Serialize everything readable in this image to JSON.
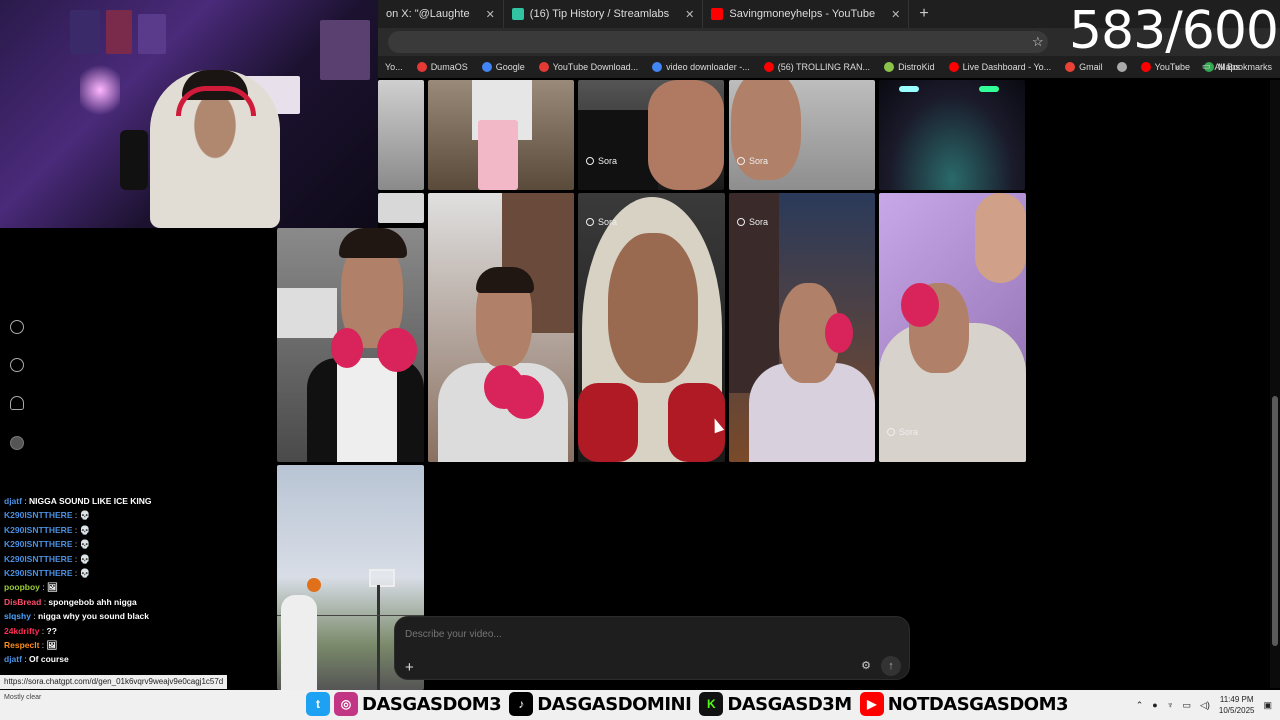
{
  "browser": {
    "tabs": [
      {
        "label": "on X: \"@Laughte",
        "color": "#ffffff"
      },
      {
        "label": "(16) Tip History / Streamlabs",
        "color": "#31c3a2"
      },
      {
        "label": "Savingmoneyhelps - YouTube",
        "color": "#ff0000"
      }
    ],
    "new_tab": "+",
    "counter": "583/600",
    "bookmarks": [
      {
        "label": "Yo...",
        "color": "#888888"
      },
      {
        "label": "DumaOS",
        "color": "#e53935"
      },
      {
        "label": "Google",
        "color": "#4285f4"
      },
      {
        "label": "YouTube Download...",
        "color": "#e53935"
      },
      {
        "label": "video downloader -...",
        "color": "#4285f4"
      },
      {
        "label": "(56) TROLLING RAN...",
        "color": "#ff0000"
      },
      {
        "label": "DistroKid",
        "color": "#8bc34a"
      },
      {
        "label": "Live Dashboard - Yo...",
        "color": "#ff0000"
      },
      {
        "label": "Gmail",
        "color": "#ea4335"
      },
      {
        "label": "",
        "color": "#aaaaaa"
      },
      {
        "label": "YouTube",
        "color": "#ff0000"
      },
      {
        "label": "Maps",
        "color": "#34a853"
      }
    ],
    "all_bookmarks": "All Bookmarks"
  },
  "sora_label": "Sora",
  "chat": [
    {
      "user": "djatf",
      "color": "#4a90e2",
      "msg": "NIGGA SOUND LIKE ICE KING"
    },
    {
      "user": "K290ISNTTHERE",
      "color": "#4a90e2",
      "msg": "💀"
    },
    {
      "user": "K290ISNTTHERE",
      "color": "#4a90e2",
      "msg": "💀"
    },
    {
      "user": "K290ISNTTHERE",
      "color": "#4a90e2",
      "msg": "💀"
    },
    {
      "user": "K290ISNTTHERE",
      "color": "#4a90e2",
      "msg": "💀"
    },
    {
      "user": "K290ISNTTHERE",
      "color": "#4a90e2",
      "msg": "💀"
    },
    {
      "user": "poopboy",
      "color": "#9acd32",
      "msg": "🖼"
    },
    {
      "user": "DisBread",
      "color": "#ff4d6d",
      "msg": "spongebob ahh nigga"
    },
    {
      "user": "slqshy",
      "color": "#4aa3ff",
      "msg": "nigga why you sound black"
    },
    {
      "user": "24kdrifty",
      "color": "#ff2d55",
      "msg": "??"
    },
    {
      "user": "Respeclt",
      "color": "#ff8c1a",
      "msg": "🖼"
    },
    {
      "user": "djatf",
      "color": "#4a90e2",
      "msg": "Of course"
    }
  ],
  "prompt": {
    "placeholder": "Describe your video...",
    "plus": "+",
    "settings": "⚙",
    "send": "↑"
  },
  "status_url": "https://sora.chatgpt.com/d/gen_01k6vqrv9weajv9e0cagj1c57d",
  "weather": "Mostly clear",
  "socials": [
    {
      "icon": "twitter-icon",
      "color": "#1da1f2",
      "glyph": "t",
      "handle": "DASGASDOM3"
    },
    {
      "icon": "instagram-icon",
      "color": "#c13584",
      "glyph": "◎",
      "handle": ""
    },
    {
      "icon": "tiktok-icon",
      "color": "#000000",
      "glyph": "♪",
      "handle": "DASGASDOMINI"
    },
    {
      "icon": "kick-icon",
      "color": "#53fc18",
      "glyph": "K",
      "handle": "DASGASD3M"
    },
    {
      "icon": "youtube-icon",
      "color": "#ff0000",
      "glyph": "▶",
      "handle": "NOTDASGASDOM3"
    }
  ],
  "clock": {
    "time": "11:49 PM",
    "date": "10/5/2025"
  }
}
